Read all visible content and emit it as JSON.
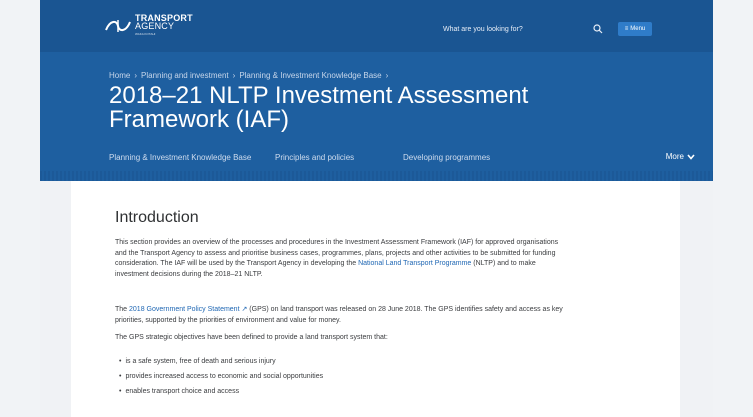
{
  "header": {
    "logo_line1": "TRANSPORT",
    "logo_line2": "AGENCY",
    "logo_line3": "WAKA KOTAHI",
    "search_placeholder": "What are you looking for?",
    "menu_label": "Menu"
  },
  "breadcrumb": [
    "Home",
    "Planning and investment",
    "Planning & Investment Knowledge Base"
  ],
  "title": "2018–21 NLTP Investment Assessment Framework (IAF)",
  "subnav": {
    "items": [
      "Planning & Investment Knowledge Base",
      "Principles and policies",
      "Developing programmes"
    ],
    "more_label": "More"
  },
  "content": {
    "heading": "Introduction",
    "p1_a": "This section provides an overview of the processes and procedures in the Investment Assessment Framework (IAF) for approved organisations and the Transport Agency to assess and prioritise business cases, programmes, plans, projects and other activities to be submitted for funding consideration.  The IAF will be used by the Transport Agency in developing the ",
    "p1_link": "National Land Transport Programme",
    "p1_b": " (NLTP) and to make investment decisions during the 2018–21 NLTP.",
    "p2_a": "The ",
    "p2_link": "2018 Government Policy Statement ↗",
    "p2_b": " (GPS) on land transport was released on 28 June 2018.  The GPS identifies safety and access as key priorities, supported by the priorities of environment and value for money.",
    "p3": "The GPS strategic objectives have been defined to provide a land transport system that:",
    "bullets": [
      "is a safe system, free of death and serious injury",
      "provides increased access to economic and social opportunities",
      "enables transport choice and access"
    ]
  },
  "colors": {
    "hero": "#1e5fa0",
    "hero_top": "#1a5592",
    "link": "#1e66b3",
    "menu_button": "#2f7cc9"
  }
}
